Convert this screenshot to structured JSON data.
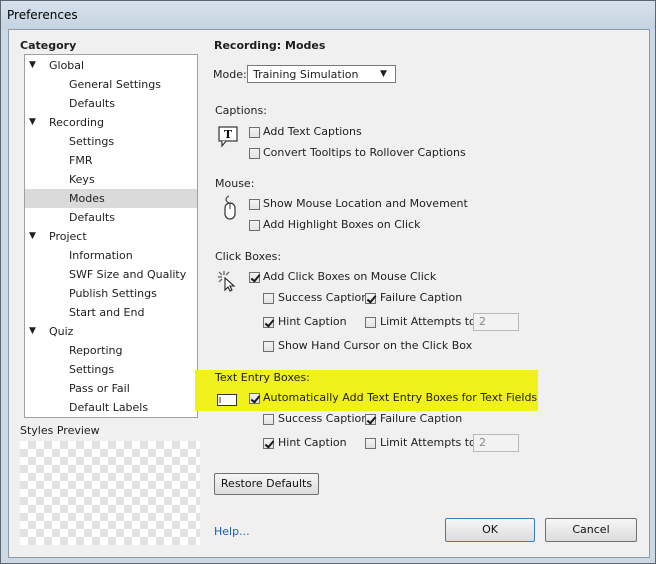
{
  "window": {
    "title": "Preferences"
  },
  "category": {
    "heading": "Category",
    "items": [
      {
        "label": "Global",
        "level": 0
      },
      {
        "label": "General Settings",
        "level": 1
      },
      {
        "label": "Defaults",
        "level": 1
      },
      {
        "label": "Recording",
        "level": 0
      },
      {
        "label": "Settings",
        "level": 1
      },
      {
        "label": "FMR",
        "level": 1
      },
      {
        "label": "Keys",
        "level": 1
      },
      {
        "label": "Modes",
        "level": 1,
        "selected": true
      },
      {
        "label": "Defaults",
        "level": 1
      },
      {
        "label": "Project",
        "level": 0
      },
      {
        "label": "Information",
        "level": 1
      },
      {
        "label": "SWF Size and Quality",
        "level": 1
      },
      {
        "label": "Publish Settings",
        "level": 1
      },
      {
        "label": "Start and End",
        "level": 1
      },
      {
        "label": "Quiz",
        "level": 0
      },
      {
        "label": "Reporting",
        "level": 1
      },
      {
        "label": "Settings",
        "level": 1
      },
      {
        "label": "Pass or Fail",
        "level": 1
      },
      {
        "label": "Default Labels",
        "level": 1
      }
    ],
    "expand_glyph": "▼"
  },
  "styles_preview": {
    "label": "Styles Preview"
  },
  "panel": {
    "title": "Recording: Modes",
    "mode_label": "Mode:",
    "mode_value": "Training Simulation",
    "captions": {
      "heading": "Captions:",
      "icon": "text-caption-icon",
      "add_text_captions": "Add Text Captions",
      "convert_tooltips": "Convert Tooltips to Rollover Captions"
    },
    "mouse": {
      "heading": "Mouse:",
      "icon": "mouse-icon",
      "show_mouse": "Show Mouse Location and Movement",
      "highlight_boxes": "Add Highlight Boxes on Click"
    },
    "click_boxes": {
      "heading": "Click Boxes:",
      "icon": "click-burst-icon",
      "add_click_boxes": "Add Click Boxes on Mouse Click",
      "success_caption": "Success Caption",
      "failure_caption": "Failure Caption",
      "hint_caption": "Hint Caption",
      "limit_attempts": "Limit Attempts to",
      "attempts_value": "2",
      "show_hand_cursor": "Show Hand Cursor on the Click Box"
    },
    "text_entry": {
      "heading": "Text Entry Boxes:",
      "icon": "text-entry-box-icon",
      "auto_add": "Automatically Add Text Entry Boxes for Text Fields",
      "success_caption": "Success Caption",
      "failure_caption": "Failure Caption",
      "hint_caption": "Hint Caption",
      "limit_attempts": "Limit Attempts to",
      "attempts_value": "2"
    },
    "restore_defaults": "Restore Defaults"
  },
  "footer": {
    "help": "Help...",
    "ok": "OK",
    "cancel": "Cancel"
  },
  "colors": {
    "highlight": "#f0f01a",
    "selection": "#dadada",
    "link": "#1c5fa8"
  }
}
